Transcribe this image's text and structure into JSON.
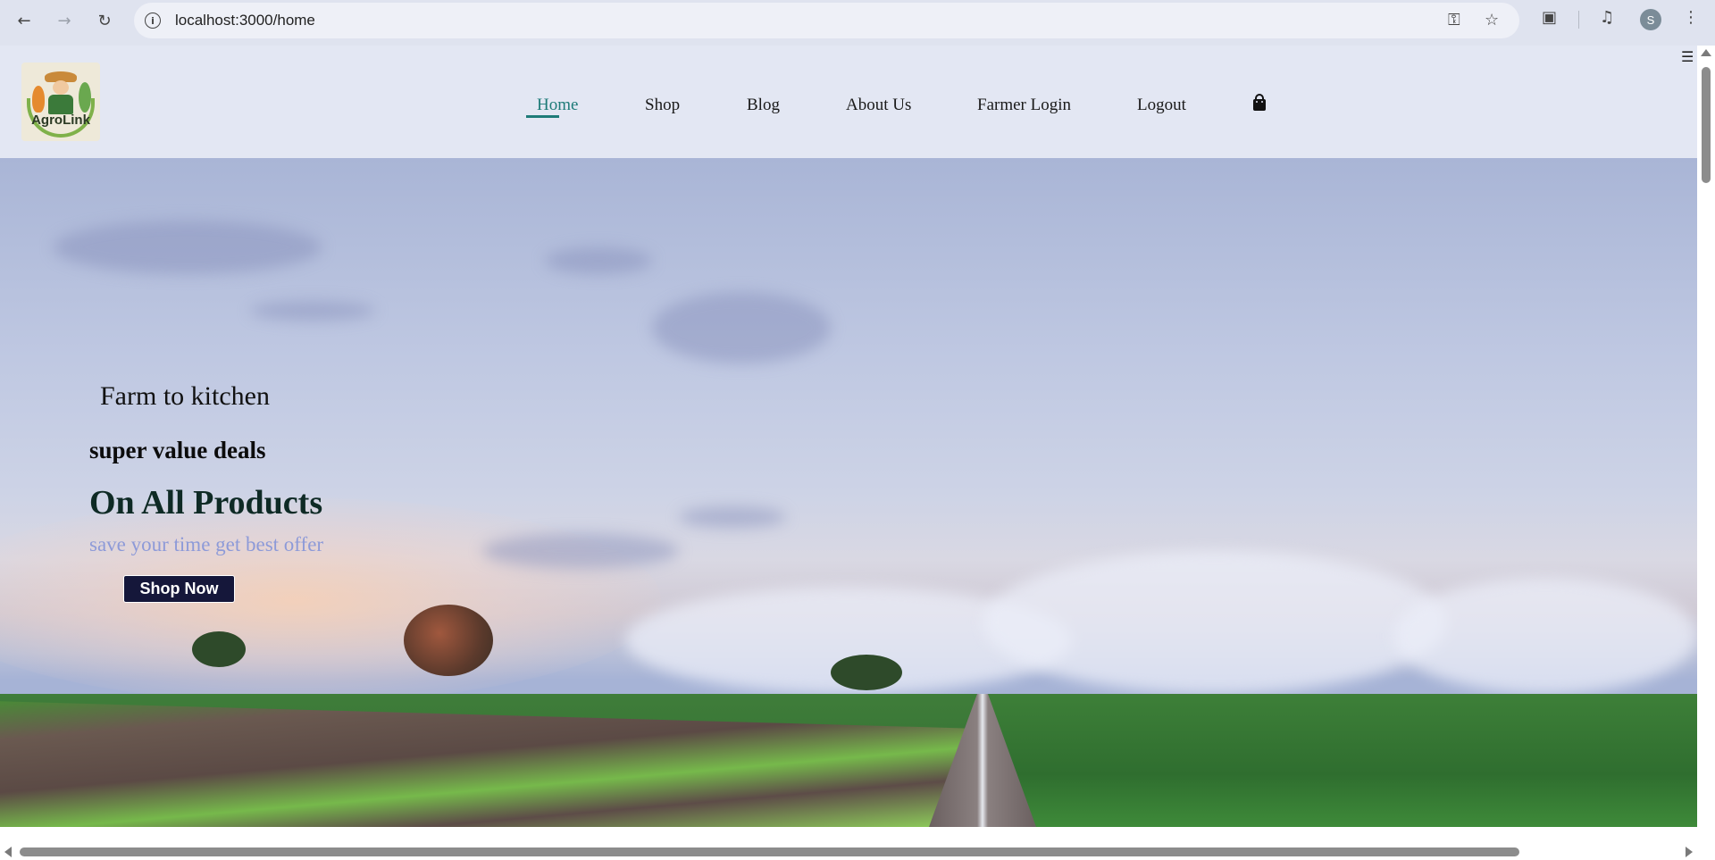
{
  "browser": {
    "url": "localhost:3000/home",
    "profile_initial": "S",
    "icons": {
      "back": "arrow-left-icon",
      "forward": "arrow-right-icon",
      "reload": "reload-icon",
      "site_info": "info-icon",
      "password": "key-icon",
      "bookmark": "star-icon",
      "extensions": "puzzle-icon",
      "media": "media-queue-icon",
      "menu": "kebab-menu-icon"
    }
  },
  "site": {
    "logo_text": "AgroLink",
    "nav": [
      {
        "label": "Home",
        "active": true
      },
      {
        "label": "Shop",
        "active": false
      },
      {
        "label": "Blog",
        "active": false
      },
      {
        "label": "About Us",
        "active": false
      },
      {
        "label": "Farmer Login",
        "active": false
      },
      {
        "label": "Logout",
        "active": false
      }
    ],
    "cart_icon": "shopping-bag-icon",
    "accent_color": "#1e7b78"
  },
  "hero": {
    "line1": "Farm to kitchen",
    "line2": "super value deals",
    "headline": "On All Products",
    "tagline": "save your time get best offer",
    "cta_label": "Shop Now",
    "cta_color": "#15173a"
  }
}
